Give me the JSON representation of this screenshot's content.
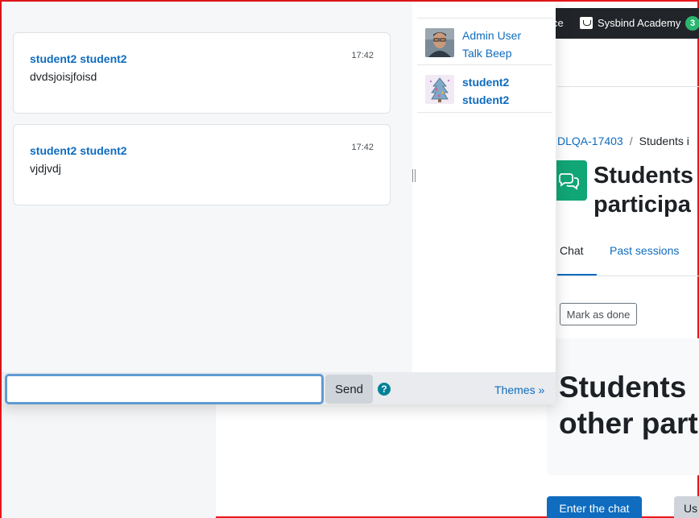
{
  "background_page": {
    "topnav": {
      "left_fragment": "ce",
      "site_name": "Sysbind Academy",
      "notification_count": "3"
    },
    "breadcrumb": {
      "course": "DLQA-17403",
      "separator": "/",
      "current": "Students i"
    },
    "page_title_line1": "Students",
    "page_title_line2": "participa",
    "tabs": [
      {
        "label": "Chat",
        "active": true
      },
      {
        "label": "Past sessions",
        "active": false
      }
    ],
    "mark_done_label": "Mark as done",
    "card_title_line1": "Students",
    "card_title_line2": "other part",
    "enter_chat_label": "Enter the chat",
    "use_label": "Us"
  },
  "chat": {
    "messages": [
      {
        "author": "student2 student2",
        "time": "17:42",
        "text": "dvdsjoisjfoisd"
      },
      {
        "author": "student2 student2",
        "time": "17:42",
        "text": "vjdjvdj"
      }
    ],
    "users": [
      {
        "name_line1": "Admin User",
        "name_line2": "Talk Beep",
        "avatar": "admin-photo-avatar",
        "bold": false
      },
      {
        "name_line1": "student2",
        "name_line2": "student2",
        "avatar": "student-drawing-avatar",
        "bold": true
      }
    ],
    "input": {
      "value": "",
      "placeholder": ""
    },
    "send_label": "Send",
    "help_icon_label": "?",
    "themes_label": "Themes »"
  },
  "colors": {
    "link_blue": "#0f6cbf",
    "activity_green": "#11a676",
    "help_teal": "#008196",
    "frame_red": "#e8171b"
  }
}
